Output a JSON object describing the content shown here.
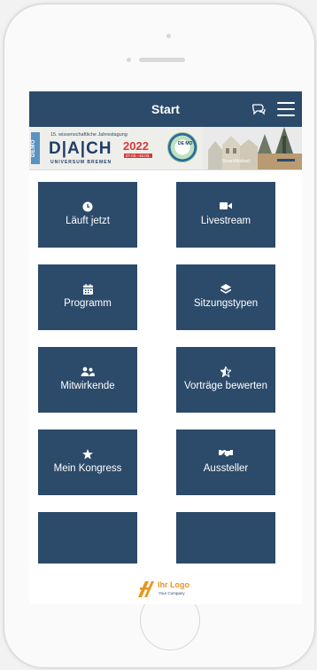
{
  "header": {
    "title": "Start"
  },
  "banner": {
    "demo_tag": "DEMO",
    "subtitle": "15. wissenschaftliche Jahrestagung",
    "name": "D|A|CH",
    "year": "2022",
    "date": "07.03.–10.03.",
    "university": "UNIVERSUM BREMEN",
    "seal": "DE MO",
    "credit": "SmartAbstract"
  },
  "tiles": [
    {
      "label": "Läuft jetzt",
      "icon": "clock-icon"
    },
    {
      "label": "Livestream",
      "icon": "video-camera-icon"
    },
    {
      "label": "Programm",
      "icon": "calendar-icon"
    },
    {
      "label": "Sitzungstypen",
      "icon": "layers-icon"
    },
    {
      "label": "Mitwirkende",
      "icon": "users-icon"
    },
    {
      "label": "Vorträge bewerten",
      "icon": "star-half-icon"
    },
    {
      "label": "Mein Kongress",
      "icon": "star-icon"
    },
    {
      "label": "Aussteller",
      "icon": "handshake-icon"
    }
  ],
  "footer": {
    "logo_text": "Ihr Logo",
    "logo_sub": "Your Company"
  },
  "colors": {
    "primary": "#2c4a6a",
    "accent": "#e8961a",
    "banner_red": "#d43a3a"
  }
}
